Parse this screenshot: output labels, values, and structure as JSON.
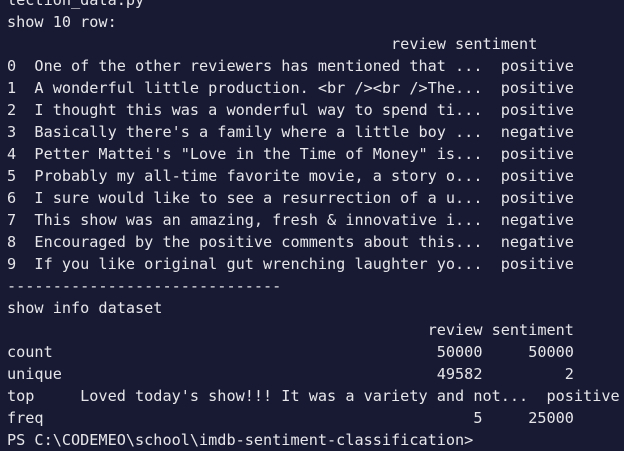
{
  "terminal": {
    "lines": [
      "lection_data.py",
      "show 10 row:",
      "                                          review sentiment",
      "0  One of the other reviewers has mentioned that ...  positive",
      "1  A wonderful little production. <br /><br />The...  positive",
      "2  I thought this was a wonderful way to spend ti...  positive",
      "3  Basically there's a family where a little boy ...  negative",
      "4  Petter Mattei's \"Love in the Time of Money\" is...  positive",
      "5  Probably my all-time favorite movie, a story o...  positive",
      "6  I sure would like to see a resurrection of a u...  positive",
      "7  This show was an amazing, fresh & innovative i...  negative",
      "8  Encouraged by the positive comments about this...  negative",
      "9  If you like original gut wrenching laughter yo...  positive",
      "------------------------------",
      "show info dataset",
      "                                              review sentiment",
      "count                                          50000     50000",
      "unique                                         49582         2",
      "top     Loved today's show!!! It was a variety and not...  positive",
      "freq                                               5     25000",
      "PS C:\\CODEMEO\\school\\imdb-sentiment-classification>"
    ]
  }
}
